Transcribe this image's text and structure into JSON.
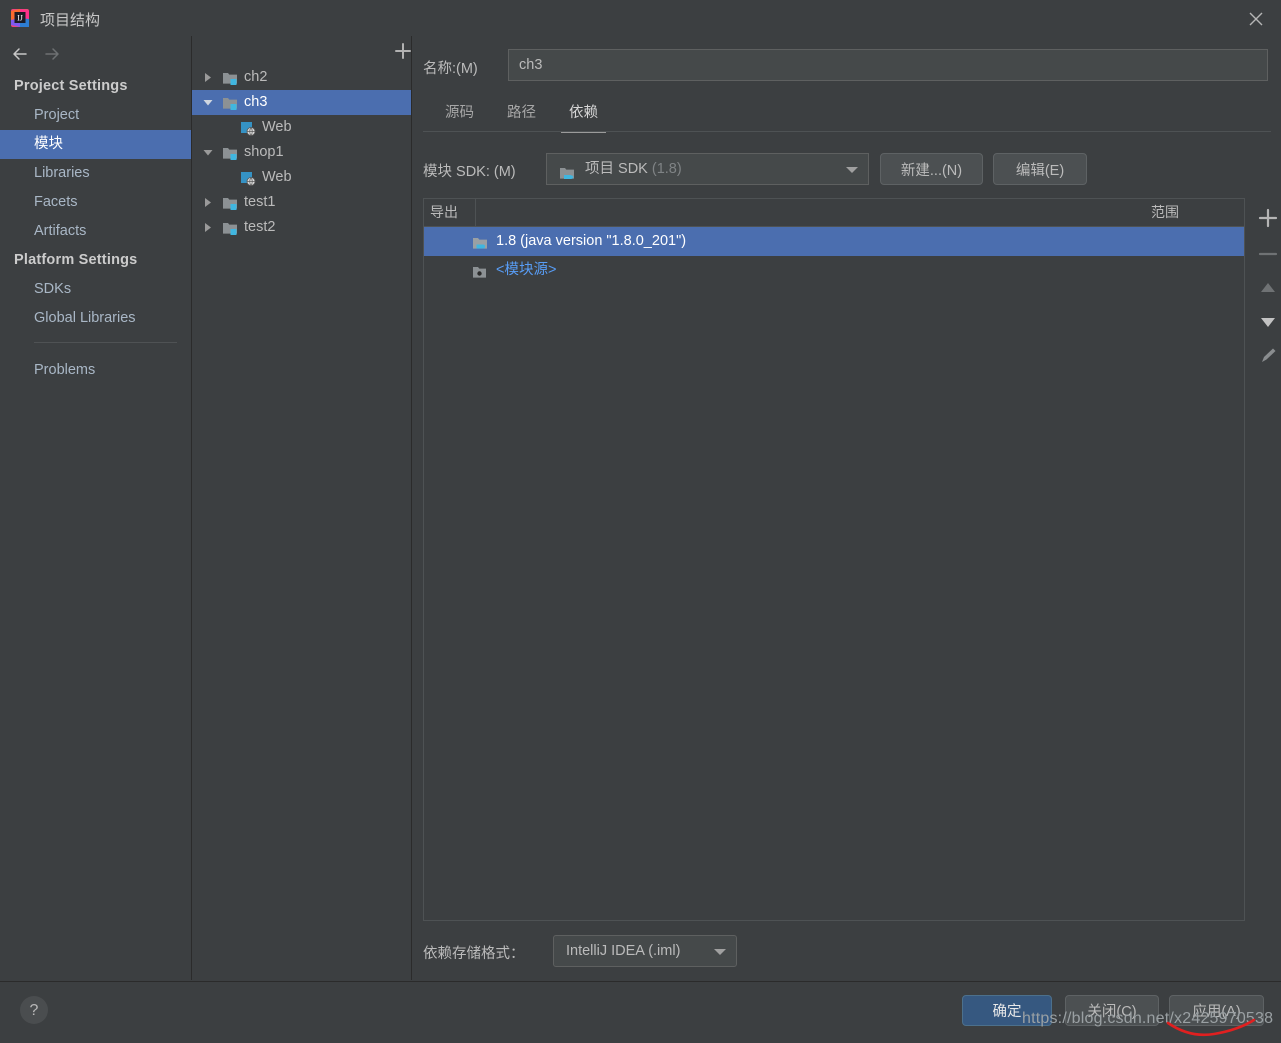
{
  "window": {
    "title": "项目结构",
    "app_icon": "intellij-idea-logo",
    "close_icon": "close-icon"
  },
  "sidebar": {
    "back_icon": "arrow-left-icon",
    "forward_icon": "arrow-right-icon",
    "groups": [
      {
        "label": "Project Settings",
        "items": [
          {
            "label": "Project",
            "selected": false
          },
          {
            "label": "模块",
            "selected": true
          },
          {
            "label": "Libraries",
            "selected": false
          },
          {
            "label": "Facets",
            "selected": false
          },
          {
            "label": "Artifacts",
            "selected": false
          }
        ]
      },
      {
        "label": "Platform Settings",
        "items": [
          {
            "label": "SDKs",
            "selected": false
          },
          {
            "label": "Global Libraries",
            "selected": false
          }
        ]
      }
    ],
    "problems": {
      "label": "Problems"
    }
  },
  "tree_panel": {
    "toolbar": {
      "add_icon": "plus-icon",
      "remove_icon": "minus-icon",
      "copy_icon": "copy-icon"
    },
    "rows": [
      {
        "label": "ch2",
        "icon": "module-folder-icon",
        "indent": 0,
        "twisty": "collapsed",
        "selected": false
      },
      {
        "label": "ch3",
        "icon": "module-folder-icon",
        "indent": 0,
        "twisty": "expanded",
        "selected": true
      },
      {
        "label": "Web",
        "icon": "web-facet-icon",
        "indent": 1,
        "twisty": "none",
        "selected": false
      },
      {
        "label": "shop1",
        "icon": "module-folder-icon",
        "indent": 0,
        "twisty": "expanded",
        "selected": false
      },
      {
        "label": "Web",
        "icon": "web-facet-icon",
        "indent": 1,
        "twisty": "none",
        "selected": false
      },
      {
        "label": "test1",
        "icon": "module-folder-icon",
        "indent": 0,
        "twisty": "collapsed",
        "selected": false
      },
      {
        "label": "test2",
        "icon": "module-folder-icon",
        "indent": 0,
        "twisty": "collapsed",
        "selected": false
      }
    ]
  },
  "detail": {
    "name_label": "名称:(M)",
    "name_value": "ch3",
    "tabs": [
      {
        "label": "源码",
        "active": false
      },
      {
        "label": "路径",
        "active": false
      },
      {
        "label": "依赖",
        "active": true
      }
    ],
    "sdk": {
      "label": "模块 SDK: (M)",
      "value": "项目 SDK",
      "value_suffix": "(1.8)",
      "icon": "jdk-icon",
      "new_button": "新建...(N)",
      "edit_button": "编辑(E)"
    },
    "table": {
      "columns": [
        {
          "label": "导出"
        },
        {
          "label": "范围"
        }
      ],
      "rows": [
        {
          "name": "1.8 (java version \"1.8.0_201\")",
          "icon": "jdk-icon",
          "scope": "",
          "selected": true,
          "link": false
        },
        {
          "name": "<模块源>",
          "icon": "module-source-icon",
          "scope": "",
          "selected": false,
          "link": true
        }
      ],
      "tools": [
        {
          "icon": "plus-icon",
          "enabled": true
        },
        {
          "icon": "minus-icon",
          "enabled": false
        },
        {
          "icon": "arrow-up-icon",
          "enabled": false
        },
        {
          "icon": "arrow-down-icon",
          "enabled": true
        },
        {
          "icon": "pencil-edit-icon",
          "enabled": false
        }
      ]
    },
    "storage": {
      "label": "依赖存储格式：",
      "value": "IntelliJ IDEA (.iml)"
    }
  },
  "footer": {
    "help_label": "?",
    "ok_label": "确定",
    "close_label": "关闭(C)",
    "apply_label": "应用(A)"
  },
  "watermark": {
    "text": "https://blog.csdn.net/x2425970538"
  },
  "colors": {
    "window_bg": "#3c3f41",
    "selection_blue": "#4b6eaf",
    "primary_button": "#365880",
    "link_blue": "#589df6",
    "text": "#bbbbbb",
    "border": "#2b2b2b",
    "watermark_underline": "#e02020"
  }
}
